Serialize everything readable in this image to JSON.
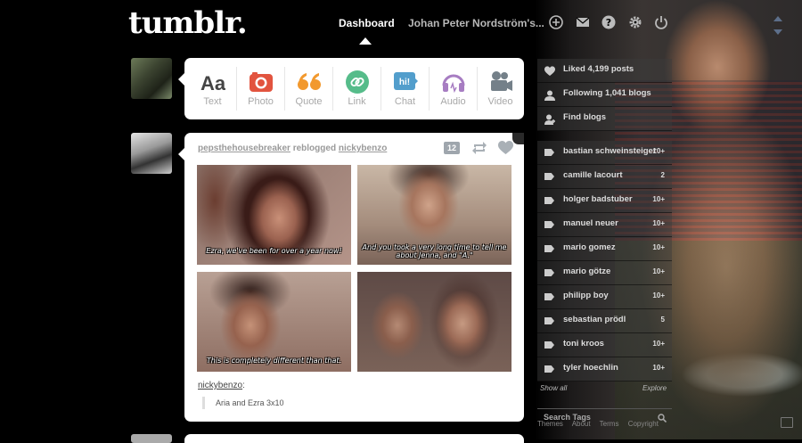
{
  "header": {
    "logo": "tumblr.",
    "nav_dashboard": "Dashboard",
    "nav_user": "Johan Peter Nordström's...",
    "icons": [
      "new-post-icon",
      "mail-icon",
      "help-icon",
      "settings-icon",
      "logout-icon"
    ]
  },
  "post_types": [
    {
      "label": "Text",
      "icon": "text-icon",
      "color": "#444444"
    },
    {
      "label": "Photo",
      "icon": "camera-icon",
      "color": "#e2543f"
    },
    {
      "label": "Quote",
      "icon": "quote-icon",
      "color": "#f2992e"
    },
    {
      "label": "Link",
      "icon": "link-icon",
      "color": "#56bc8a"
    },
    {
      "label": "Chat",
      "icon": "chat-icon",
      "color": "#529ecc"
    },
    {
      "label": "Audio",
      "icon": "headphones-icon",
      "color": "#a77dc2"
    },
    {
      "label": "Video",
      "icon": "video-camera-icon",
      "color": "#748089"
    }
  ],
  "post": {
    "author": "pepsthehousebreaker",
    "action": "reblogged",
    "source": "nickybenzo",
    "notes": "12",
    "captions": [
      "Ezra, we've been for over a year now!",
      "And you took a very long time to tell me about Jenna, and \"A.\"",
      "This is completely different than that.",
      ""
    ],
    "caption_user": "nickybenzo",
    "caption_text": "Aria and Ezra 3x10"
  },
  "sidebar": {
    "stats": [
      {
        "label": "Liked 4,199 posts",
        "icon": "heart-icon"
      },
      {
        "label": "Following 1,041 blogs",
        "icon": "person-icon"
      },
      {
        "label": "Find blogs",
        "icon": "add-person-icon"
      }
    ],
    "tags": [
      {
        "name": "bastian schweinsteiger",
        "count": "10+"
      },
      {
        "name": "camille lacourt",
        "count": "2"
      },
      {
        "name": "holger badstuber",
        "count": "10+"
      },
      {
        "name": "manuel neuer",
        "count": "10+"
      },
      {
        "name": "mario gomez",
        "count": "10+"
      },
      {
        "name": "mario götze",
        "count": "10+"
      },
      {
        "name": "philipp boy",
        "count": "10+"
      },
      {
        "name": "sebastian prödl",
        "count": "5"
      },
      {
        "name": "toni kroos",
        "count": "10+"
      },
      {
        "name": "tyler hoechlin",
        "count": "10+"
      }
    ],
    "show_all": "Show all",
    "explore": "Explore",
    "search_tags": "Search Tags",
    "footer": [
      "Themes",
      "About",
      "Terms",
      "Copyright"
    ]
  }
}
